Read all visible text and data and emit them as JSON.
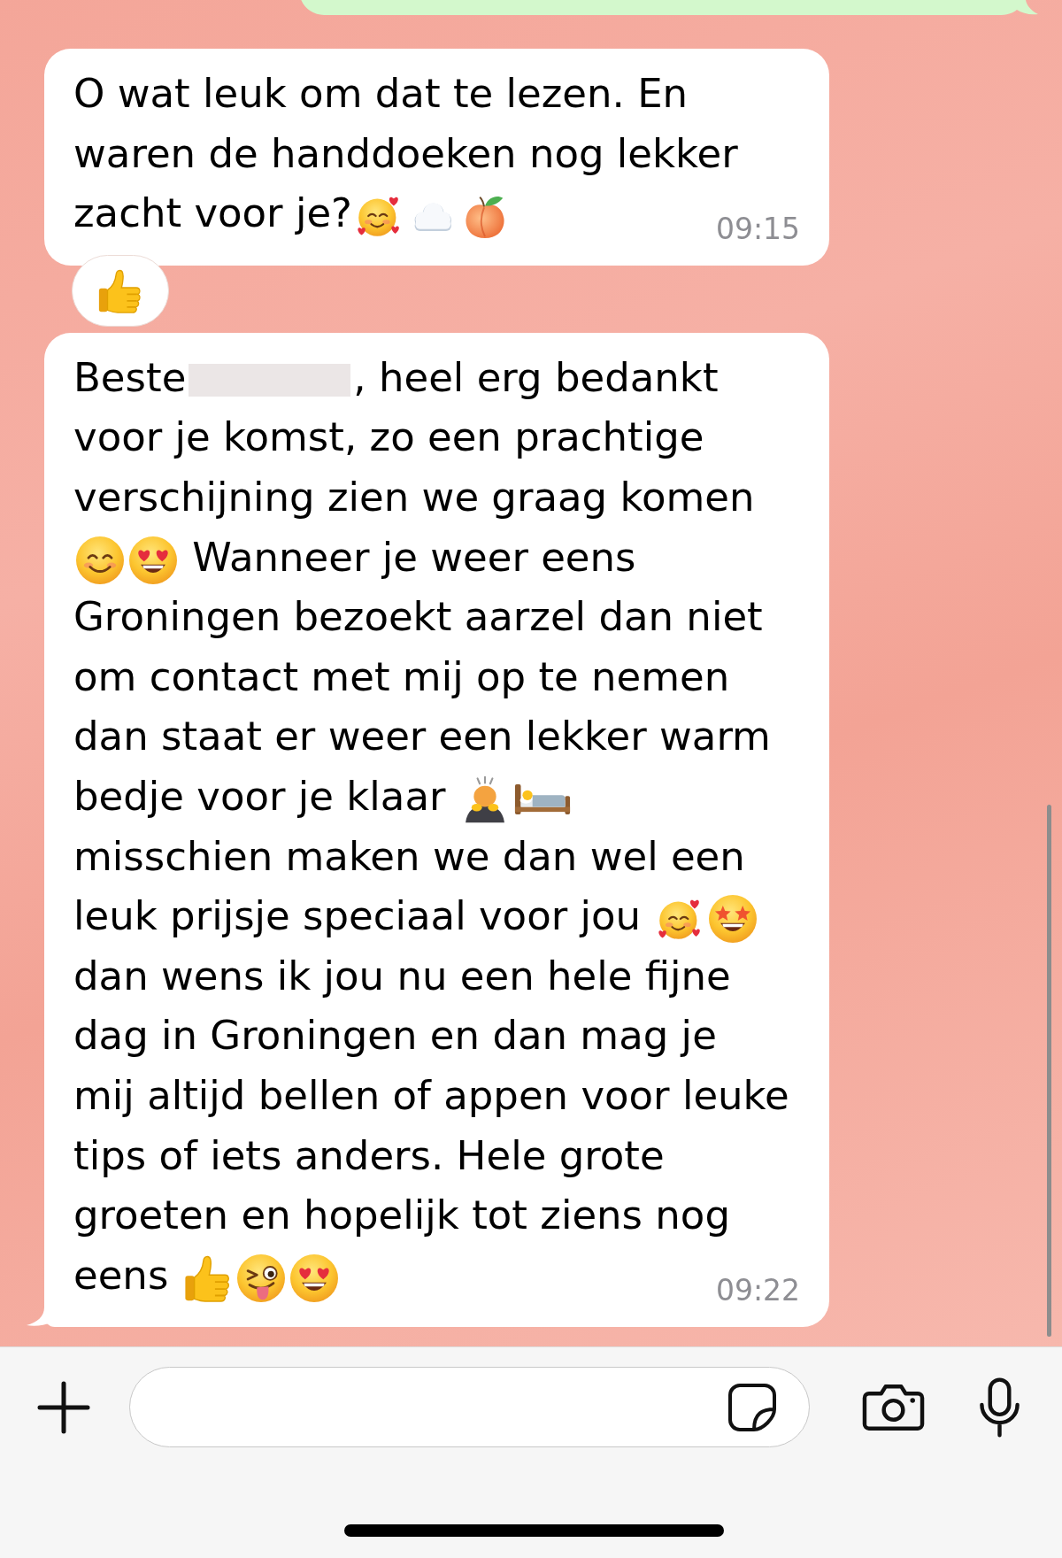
{
  "chat": {
    "messages": [
      {
        "kind": "outgoing",
        "tail": true
      },
      {
        "kind": "incoming",
        "tail": false,
        "segments": [
          {
            "kind": "text",
            "text": "O wat leuk om dat te lezen. En\nwaren de handdoeken nog lekker\nzacht voor je?"
          },
          {
            "kind": "hearts"
          },
          {
            "kind": "cloud"
          },
          {
            "kind": "peach"
          }
        ],
        "time": "09:15",
        "reactions": [
          {
            "kind": "thumbsup"
          }
        ]
      },
      {
        "kind": "incoming",
        "tail": true,
        "segments": [
          {
            "kind": "text",
            "text": "Beste"
          },
          {
            "kind": "redacted"
          },
          {
            "kind": "text",
            "text": ", heel erg bedankt\nvoor je komst, zo een prachtige\nverschijning zien we graag komen\n"
          },
          {
            "kind": "smile"
          },
          {
            "kind": "hearteyes"
          },
          {
            "kind": "text",
            "text": " Wanneer je weer eens\nGroningen bezoekt aarzel dan niet\nom contact met mij op te nemen\ndan staat er weer een lekker warm\nbedje voor je klaar "
          },
          {
            "kind": "bowing"
          },
          {
            "kind": "bed"
          },
          {
            "kind": "text",
            "text": "\nmisschien maken we dan wel een\nleuk prijsje speciaal voor jou "
          },
          {
            "kind": "hearts"
          },
          {
            "kind": "starstruck"
          },
          {
            "kind": "text",
            "text": "\ndan wens ik jou nu een hele fijne\ndag in Groningen en dan mag je\nmij altijd bellen of appen voor leuke\ntips of iets anders. Hele grote\ngroeten en hopelijk tot ziens nog\neens "
          },
          {
            "kind": "thumbsup"
          },
          {
            "kind": "wink"
          },
          {
            "kind": "hearteyes"
          }
        ],
        "time": "09:22"
      }
    ]
  }
}
